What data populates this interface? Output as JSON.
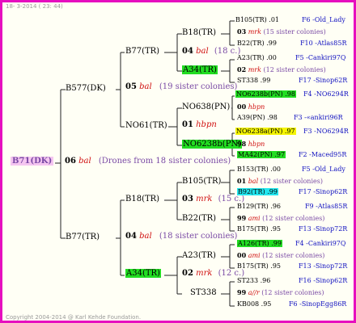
{
  "header": "18- 3-2014 ( 23: 44)",
  "footer": "Copyright 2004-2014 @ Karl Kehde Foundation.",
  "root": {
    "id": "B71(DK)",
    "num": "06",
    "sym": "bal",
    "note": "(Drones from 18 sister colonies)"
  },
  "gen1": {
    "upper": {
      "id": "B577(DK)",
      "num": "05",
      "sym": "bal",
      "note": "(19 sister colonies)"
    },
    "lower": {
      "id": "B77(TR)",
      "num": "04",
      "sym": "bal",
      "note": "(18 sister colonies)"
    }
  },
  "gen2": {
    "a": {
      "id": "B77(TR)",
      "num": "04",
      "sym": "bal",
      "note": "(18 c.)"
    },
    "b": {
      "id": "NO61(TR)",
      "num": "01",
      "sym": "hbpn"
    },
    "c": {
      "id": "B18(TR)",
      "num": "03",
      "sym": "mrk",
      "note": "(15 c.)"
    },
    "d": {
      "id": "A34(TR)",
      "num": "02",
      "sym": "mrk",
      "note": "(12 c.)"
    }
  },
  "gen3": {
    "a1": "B18(TR)",
    "a2": "A34(TR)",
    "b1": "NO638(PN)",
    "b2": "NO6238b(PN)",
    "c1": "B105(TR)",
    "c2": "B22(TR)",
    "d1": "A23(TR)",
    "d2": "ST338"
  },
  "leaves": [
    {
      "p1": "B105(TR) .01",
      "p1_hl": "",
      "right": "F6 -Old_Lady",
      "num": "03",
      "sym": "mrk",
      "note": "(15 sister colonies)",
      "p2": "B22(TR) .99",
      "p2_hl": "",
      "right2": "F10 -Atlas85R"
    },
    {
      "p1": "A23(TR) .00",
      "p1_hl": "",
      "right": "F5 -Cankiri97Q",
      "num": "02",
      "sym": "mrk",
      "note": "(12 sister colonies)",
      "p2": "ST338 .99",
      "p2_hl": "",
      "right2": "F17 -Sinop62R"
    },
    {
      "p1": "NO6238b(PN) .98",
      "p1_hl": "green",
      "right": "F4 -NO6294R",
      "num": "00",
      "sym": "hbpn",
      "note": "",
      "p2": "A39(PN) .98",
      "p2_hl": "",
      "right2": "F3 -«ankiri96R"
    },
    {
      "p1": "NO6238a(PN) .97",
      "p1_hl": "yellow",
      "right": "F3 -NO6294R",
      "num": "98",
      "sym": "hbpn",
      "note": "",
      "p2": "MA42(PN) .97",
      "p2_hl": "green",
      "right2": "F2 -Maced95R"
    },
    {
      "p1": "B153(TR) .00",
      "p1_hl": "",
      "right": "F5 -Old_Lady",
      "num": "01",
      "sym": "bal",
      "note": "(12 sister colonies)",
      "p2": "B92(TR) .99",
      "p2_hl": "cyan",
      "right2": "F17 -Sinop62R"
    },
    {
      "p1": "B129(TR) .96",
      "p1_hl": "",
      "right": "F9 -Atlas85R",
      "num": "99",
      "sym": "ami",
      "note": "(12 sister colonies)",
      "p2": "B175(TR) .95",
      "p2_hl": "",
      "right2": "F13 -Sinop72R"
    },
    {
      "p1": "A126(TR) .99",
      "p1_hl": "green",
      "right": "F4 -Cankiri97Q",
      "num": "00",
      "sym": "ami",
      "note": "(12 sister colonies)",
      "p2": "B175(TR) .95",
      "p2_hl": "",
      "right2": "F13 -Sinop72R"
    },
    {
      "p1": "ST233 .96",
      "p1_hl": "",
      "right": "F16 -Sinop62R",
      "num": "99",
      "sym": "a//r",
      "note": "(12 sister colonies)",
      "p2": "KB008 .95",
      "p2_hl": "",
      "right2": "F6 -SinopEgg86R"
    }
  ]
}
